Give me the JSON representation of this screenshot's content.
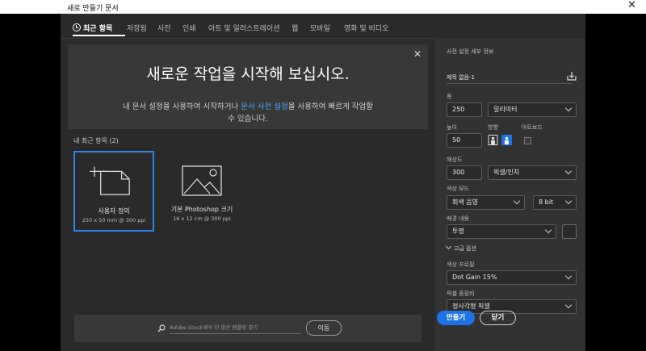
{
  "window": {
    "title": "새로 만들기 문서",
    "close_glyph": "✕"
  },
  "tabs": [
    {
      "label": "최근 항목"
    },
    {
      "label": "저장됨"
    },
    {
      "label": "사진"
    },
    {
      "label": "인쇄"
    },
    {
      "label": "아트 및 일러스트레이션"
    },
    {
      "label": "웹"
    },
    {
      "label": "모바일"
    },
    {
      "label": "영화 및 비디오"
    }
  ],
  "banner": {
    "title": "새로운 작업을 시작해 보십시오.",
    "text_before": "내 문서 설정을 사용하여 시작하거나 ",
    "link": "문서 사전 설정",
    "text_after": "을 사용하여 빠르게 작업할 수 있습니다.",
    "close_glyph": "✕"
  },
  "recent": {
    "label": "내 최근 항목",
    "count": "(2)",
    "items": [
      {
        "name": "사용자 정의",
        "sub": "250 x 50 mm @ 300 ppi"
      },
      {
        "name": "기본 Photoshop 크기",
        "sub": "16 x 12 cm @ 300 ppi"
      }
    ]
  },
  "search": {
    "placeholder": "Adobe Stock에서 더 많은 템플릿 찾기",
    "go_label": "이동"
  },
  "preset": {
    "header": "사전 설정 세부 정보",
    "doc_name": "제목 없음-1",
    "width_label": "폭",
    "width_value": "250",
    "width_unit": "밀리미터",
    "height_label": "높이",
    "height_value": "50",
    "orientation_label": "방향",
    "artboard_label": "아트보드",
    "resolution_label": "해상도",
    "resolution_value": "300",
    "resolution_unit": "픽셀/인치",
    "color_mode_label": "색상 모드",
    "color_mode_value": "회색 음영",
    "bit_depth_value": "8 bit",
    "background_label": "배경 내용",
    "background_value": "투명",
    "advanced_label": "고급 옵션",
    "color_profile_label": "색상 프로필",
    "color_profile_value": "Dot Gain 15%",
    "pixel_aspect_label": "픽셀 종횡비",
    "pixel_aspect_value": "정사각형 픽셀"
  },
  "actions": {
    "create_label": "만들기",
    "close_label": "닫기"
  },
  "colors": {
    "accent": "#1f73e8",
    "selected_border": "#2b84e6",
    "link": "#4ba6ff"
  }
}
